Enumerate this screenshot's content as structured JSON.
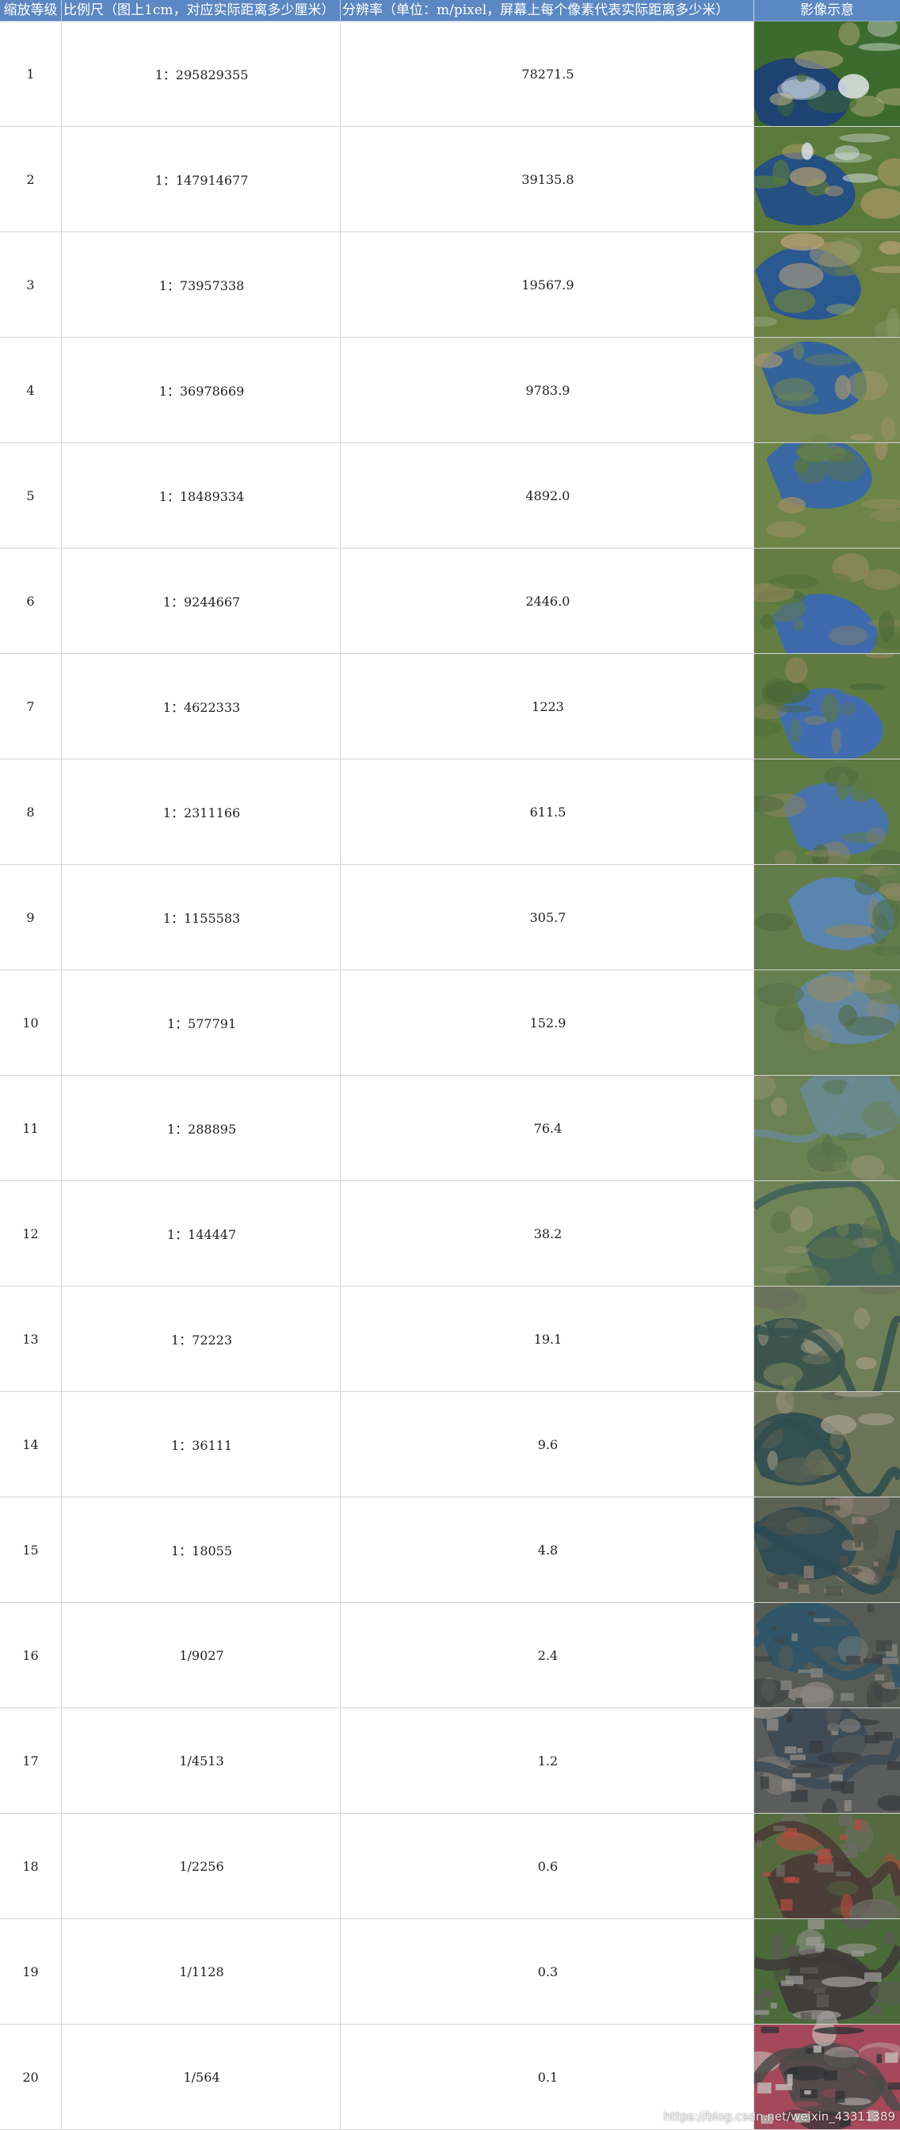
{
  "table": {
    "headers": {
      "level": "缩放等级",
      "scale": "比例尺（图上1cm，对应实际距离多少厘米）",
      "resolution": "分辨率（单位：m/pixel，屏幕上每个像素代表实际距离多少米）",
      "image": "影像示意"
    },
    "rows": [
      {
        "level": "1",
        "scale": "1：295829355",
        "resolution": "78271.5",
        "thumb": "globe-world",
        "colors": [
          "#1b3f7a",
          "#3d6a2f",
          "#c8b48a",
          "#eef2f6"
        ]
      },
      {
        "level": "2",
        "scale": "1：147914677",
        "resolution": "39135.8",
        "thumb": "globe-eurasia",
        "colors": [
          "#1e4b8c",
          "#5a7a3c",
          "#b59d6d",
          "#dfe7ef"
        ]
      },
      {
        "level": "3",
        "scale": "1：73957338",
        "resolution": "19567.9",
        "thumb": "asia-continent",
        "colors": [
          "#24549a",
          "#6b7f43",
          "#b8a179",
          "#8a9b6b"
        ]
      },
      {
        "level": "4",
        "scale": "1：36978669",
        "resolution": "9783.9",
        "thumb": "china-region",
        "colors": [
          "#2c5ea4",
          "#7a8a55",
          "#a8976e",
          "#6f8551"
        ]
      },
      {
        "level": "5",
        "scale": "1：18489334",
        "resolution": "4892.0",
        "thumb": "north-china",
        "colors": [
          "#3465ac",
          "#6d8548",
          "#9c8e66",
          "#5b7740"
        ]
      },
      {
        "level": "6",
        "scale": "1：9244667",
        "resolution": "2446.0",
        "thumb": "bohai-sea",
        "colors": [
          "#3a67b8",
          "#647d43",
          "#94895f",
          "#4e6c3a"
        ]
      },
      {
        "level": "7",
        "scale": "1：4622333",
        "resolution": "1223",
        "thumb": "bohai-bay",
        "colors": [
          "#3e6bbd",
          "#5e7a41",
          "#8d845b",
          "#4a6837"
        ]
      },
      {
        "level": "8",
        "scale": "1：2311166",
        "resolution": "611.5",
        "thumb": "tianjin-coast",
        "colors": [
          "#4672b7",
          "#5d7b44",
          "#8a845d",
          "#4b6a3b"
        ]
      },
      {
        "level": "9",
        "scale": "1：1155583",
        "resolution": "305.7",
        "thumb": "coastline",
        "colors": [
          "#5a86b9",
          "#627d4a",
          "#8b8763",
          "#4f6b3f"
        ]
      },
      {
        "level": "10",
        "scale": "1：577791",
        "resolution": "152.9",
        "thumb": "coastal-plain",
        "colors": [
          "#6389a8",
          "#667f4f",
          "#8f8b68",
          "#536c45"
        ]
      },
      {
        "level": "11",
        "scale": "1：288895",
        "resolution": "76.4",
        "thumb": "farmland",
        "colors": [
          "#6a8a93",
          "#6a8253",
          "#91906f",
          "#57714a"
        ]
      },
      {
        "level": "12",
        "scale": "1：144447",
        "resolution": "38.2",
        "thumb": "river-fields",
        "colors": [
          "#3f5f5a",
          "#6e8456",
          "#98946f",
          "#5a7349"
        ]
      },
      {
        "level": "13",
        "scale": "1：72223",
        "resolution": "19.1",
        "thumb": "river-town",
        "colors": [
          "#36524e",
          "#6f7f58",
          "#a19a82",
          "#6a6f5c"
        ]
      },
      {
        "level": "14",
        "scale": "1：36111",
        "resolution": "9.6",
        "thumb": "river-city",
        "colors": [
          "#2f4c4f",
          "#6d7559",
          "#a7a08d",
          "#5e6454"
        ]
      },
      {
        "level": "15",
        "scale": "1：18055",
        "resolution": "4.8",
        "thumb": "city-river",
        "colors": [
          "#2b4a55",
          "#5c6253",
          "#8c7f72",
          "#4f5149"
        ]
      },
      {
        "level": "16",
        "scale": "1/9027",
        "resolution": "2.4",
        "thumb": "city-blocks",
        "colors": [
          "#2e5569",
          "#575b55",
          "#8a8680",
          "#3f4344"
        ]
      },
      {
        "level": "17",
        "scale": "1/4513",
        "resolution": "1.2",
        "thumb": "urban",
        "colors": [
          "#3b4a57",
          "#5a5d5c",
          "#948f88",
          "#383b3d"
        ]
      },
      {
        "level": "18",
        "scale": "1/2256",
        "resolution": "0.6",
        "thumb": "stadium-area",
        "colors": [
          "#4a3a36",
          "#556b3f",
          "#b14b3f",
          "#6d6a66"
        ]
      },
      {
        "level": "19",
        "scale": "1/1128",
        "resolution": "0.3",
        "thumb": "stadium",
        "colors": [
          "#3e3a3a",
          "#4b6a3a",
          "#9b9a96",
          "#5d5a57"
        ]
      },
      {
        "level": "20",
        "scale": "1/564",
        "resolution": "0.1",
        "thumb": "building-roof",
        "colors": [
          "#4c4a4a",
          "#a5495a",
          "#c8c4c0",
          "#2f3336"
        ]
      }
    ]
  },
  "watermark": "https://blog.csdn.net/weixin_43311389"
}
